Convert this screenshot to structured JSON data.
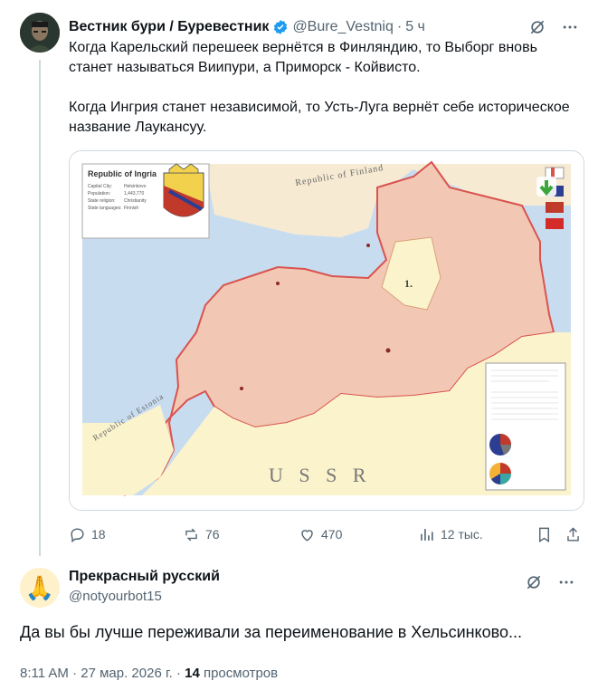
{
  "post": {
    "author_name": "Вестник бури / Буревестник",
    "handle": "@Bure_Vestniq",
    "time": "5 ч",
    "text1": "Когда Карельский перешеек вернётся в Финляндию, то Выборг вновь станет называться Виипури, а Приморск - Койвисто.",
    "text2": "Когда Ингрия станет независимой, то Усть-Луга вернёт себе историческое название Лаукансуу.",
    "stats": {
      "replies": "18",
      "reposts": "76",
      "likes": "470",
      "views": "12 тыс."
    }
  },
  "map": {
    "title": "Republic of Ingria",
    "info_keys": [
      "Capital City:",
      "Population:",
      "State religion:",
      "State languages:"
    ],
    "info_vals": [
      "Helsinkovo",
      "1,443,770",
      "Christianity",
      "Finnish"
    ],
    "label_finland": "Republic of Finland",
    "label_estonia": "Republic of Estonia",
    "label_ussr": "U S S R",
    "label_territory": "1.",
    "colors": {
      "water": "#c8dcef",
      "ingria": "#f2c8b4",
      "land": "#fbf3cc",
      "border": "#d9534f",
      "finland": "#f6ead3"
    }
  },
  "reply": {
    "author_name": "Прекрасный русский",
    "handle": "@notyourbot15",
    "avatar_icon": "🙏",
    "text": "Да вы бы лучше переживали за переименование в Хельсинково...",
    "time": "8:11 AM · 27 мар. 2026 г. · ",
    "views_count": "14",
    "views_label": " просмотров"
  }
}
